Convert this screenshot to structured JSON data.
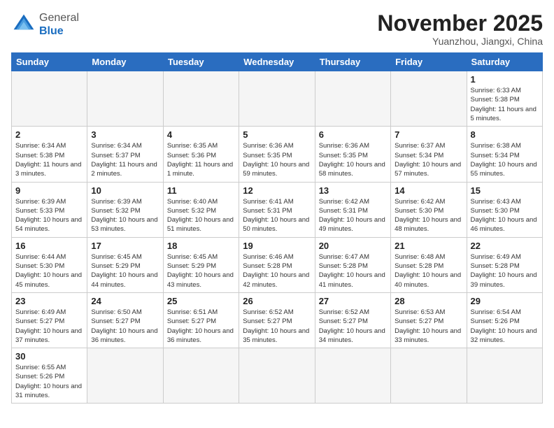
{
  "header": {
    "logo_general": "General",
    "logo_blue": "Blue",
    "month_title": "November 2025",
    "location": "Yuanzhou, Jiangxi, China"
  },
  "weekdays": [
    "Sunday",
    "Monday",
    "Tuesday",
    "Wednesday",
    "Thursday",
    "Friday",
    "Saturday"
  ],
  "days": [
    {
      "date": 1,
      "sunrise": "6:33 AM",
      "sunset": "5:38 PM",
      "daylight": "11 hours and 5 minutes."
    },
    {
      "date": 2,
      "sunrise": "6:34 AM",
      "sunset": "5:38 PM",
      "daylight": "11 hours and 3 minutes."
    },
    {
      "date": 3,
      "sunrise": "6:34 AM",
      "sunset": "5:37 PM",
      "daylight": "11 hours and 2 minutes."
    },
    {
      "date": 4,
      "sunrise": "6:35 AM",
      "sunset": "5:36 PM",
      "daylight": "11 hours and 1 minute."
    },
    {
      "date": 5,
      "sunrise": "6:36 AM",
      "sunset": "5:35 PM",
      "daylight": "10 hours and 59 minutes."
    },
    {
      "date": 6,
      "sunrise": "6:36 AM",
      "sunset": "5:35 PM",
      "daylight": "10 hours and 58 minutes."
    },
    {
      "date": 7,
      "sunrise": "6:37 AM",
      "sunset": "5:34 PM",
      "daylight": "10 hours and 57 minutes."
    },
    {
      "date": 8,
      "sunrise": "6:38 AM",
      "sunset": "5:34 PM",
      "daylight": "10 hours and 55 minutes."
    },
    {
      "date": 9,
      "sunrise": "6:39 AM",
      "sunset": "5:33 PM",
      "daylight": "10 hours and 54 minutes."
    },
    {
      "date": 10,
      "sunrise": "6:39 AM",
      "sunset": "5:32 PM",
      "daylight": "10 hours and 53 minutes."
    },
    {
      "date": 11,
      "sunrise": "6:40 AM",
      "sunset": "5:32 PM",
      "daylight": "10 hours and 51 minutes."
    },
    {
      "date": 12,
      "sunrise": "6:41 AM",
      "sunset": "5:31 PM",
      "daylight": "10 hours and 50 minutes."
    },
    {
      "date": 13,
      "sunrise": "6:42 AM",
      "sunset": "5:31 PM",
      "daylight": "10 hours and 49 minutes."
    },
    {
      "date": 14,
      "sunrise": "6:42 AM",
      "sunset": "5:30 PM",
      "daylight": "10 hours and 48 minutes."
    },
    {
      "date": 15,
      "sunrise": "6:43 AM",
      "sunset": "5:30 PM",
      "daylight": "10 hours and 46 minutes."
    },
    {
      "date": 16,
      "sunrise": "6:44 AM",
      "sunset": "5:30 PM",
      "daylight": "10 hours and 45 minutes."
    },
    {
      "date": 17,
      "sunrise": "6:45 AM",
      "sunset": "5:29 PM",
      "daylight": "10 hours and 44 minutes."
    },
    {
      "date": 18,
      "sunrise": "6:45 AM",
      "sunset": "5:29 PM",
      "daylight": "10 hours and 43 minutes."
    },
    {
      "date": 19,
      "sunrise": "6:46 AM",
      "sunset": "5:28 PM",
      "daylight": "10 hours and 42 minutes."
    },
    {
      "date": 20,
      "sunrise": "6:47 AM",
      "sunset": "5:28 PM",
      "daylight": "10 hours and 41 minutes."
    },
    {
      "date": 21,
      "sunrise": "6:48 AM",
      "sunset": "5:28 PM",
      "daylight": "10 hours and 40 minutes."
    },
    {
      "date": 22,
      "sunrise": "6:49 AM",
      "sunset": "5:28 PM",
      "daylight": "10 hours and 39 minutes."
    },
    {
      "date": 23,
      "sunrise": "6:49 AM",
      "sunset": "5:27 PM",
      "daylight": "10 hours and 37 minutes."
    },
    {
      "date": 24,
      "sunrise": "6:50 AM",
      "sunset": "5:27 PM",
      "daylight": "10 hours and 36 minutes."
    },
    {
      "date": 25,
      "sunrise": "6:51 AM",
      "sunset": "5:27 PM",
      "daylight": "10 hours and 36 minutes."
    },
    {
      "date": 26,
      "sunrise": "6:52 AM",
      "sunset": "5:27 PM",
      "daylight": "10 hours and 35 minutes."
    },
    {
      "date": 27,
      "sunrise": "6:52 AM",
      "sunset": "5:27 PM",
      "daylight": "10 hours and 34 minutes."
    },
    {
      "date": 28,
      "sunrise": "6:53 AM",
      "sunset": "5:27 PM",
      "daylight": "10 hours and 33 minutes."
    },
    {
      "date": 29,
      "sunrise": "6:54 AM",
      "sunset": "5:26 PM",
      "daylight": "10 hours and 32 minutes."
    },
    {
      "date": 30,
      "sunrise": "6:55 AM",
      "sunset": "5:26 PM",
      "daylight": "10 hours and 31 minutes."
    }
  ]
}
